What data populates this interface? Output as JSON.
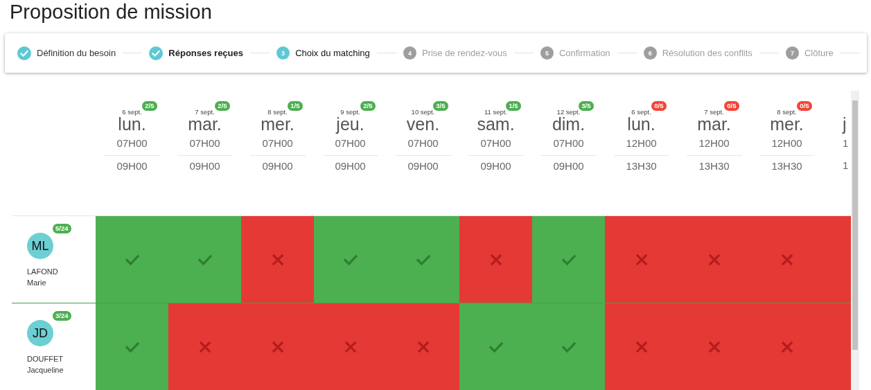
{
  "page_title": "Proposition de mission",
  "steps": [
    {
      "label": "Définition du besoin",
      "completed": true,
      "active": false,
      "emphasized": false
    },
    {
      "label": "Réponses reçues",
      "completed": true,
      "active": false,
      "emphasized": true
    },
    {
      "number": "3",
      "label": "Choix du matching",
      "completed": false,
      "active": true,
      "emphasized": false
    },
    {
      "number": "4",
      "label": "Prise de rendez-vous",
      "completed": false,
      "active": false,
      "emphasized": false
    },
    {
      "number": "5",
      "label": "Confirmation",
      "completed": false,
      "active": false,
      "emphasized": false
    },
    {
      "number": "6",
      "label": "Résolution des conflits",
      "completed": false,
      "active": false,
      "emphasized": false
    },
    {
      "number": "7",
      "label": "Clôture",
      "completed": false,
      "active": false,
      "emphasized": false
    }
  ],
  "slots": [
    {
      "date": "6 sept.",
      "day": "lun.",
      "start": "07H00",
      "end": "09H00",
      "count": "2/5",
      "color": "#4caf50"
    },
    {
      "date": "7 sept.",
      "day": "mar.",
      "start": "07H00",
      "end": "09H00",
      "count": "2/5",
      "color": "#4caf50"
    },
    {
      "date": "8 sept.",
      "day": "mer.",
      "start": "07H00",
      "end": "09H00",
      "count": "1/5",
      "color": "#4caf50"
    },
    {
      "date": "9 sept.",
      "day": "jeu.",
      "start": "07H00",
      "end": "09H00",
      "count": "2/5",
      "color": "#4caf50"
    },
    {
      "date": "10 sept.",
      "day": "ven.",
      "start": "07H00",
      "end": "09H00",
      "count": "3/5",
      "color": "#4caf50"
    },
    {
      "date": "11 sept.",
      "day": "sam.",
      "start": "07H00",
      "end": "09H00",
      "count": "1/5",
      "color": "#4caf50"
    },
    {
      "date": "12 sept.",
      "day": "dim.",
      "start": "07H00",
      "end": "09H00",
      "count": "3/5",
      "color": "#4caf50"
    },
    {
      "date": "6 sept.",
      "day": "lun.",
      "start": "12H00",
      "end": "13H30",
      "count": "0/5",
      "color": "#f44336"
    },
    {
      "date": "7 sept.",
      "day": "mar.",
      "start": "12H00",
      "end": "13H30",
      "count": "0/5",
      "color": "#f44336"
    },
    {
      "date": "8 sept.",
      "day": "mer.",
      "start": "12H00",
      "end": "13H30",
      "count": "0/5",
      "color": "#f44336"
    },
    {
      "kind": "partial",
      "day": "j",
      "start": "1",
      "end": "1"
    }
  ],
  "people": [
    {
      "initials": "ML",
      "count": "5/24",
      "last_name": "LAFOND",
      "first_name": "Marie",
      "availability": [
        true,
        true,
        false,
        true,
        true,
        false,
        true,
        false,
        false,
        false,
        false
      ]
    },
    {
      "initials": "JD",
      "count": "3/24",
      "last_name": "DOUFFET",
      "first_name": "Jacqueline",
      "availability": [
        true,
        false,
        false,
        false,
        false,
        true,
        true,
        false,
        false,
        false,
        false
      ]
    }
  ]
}
